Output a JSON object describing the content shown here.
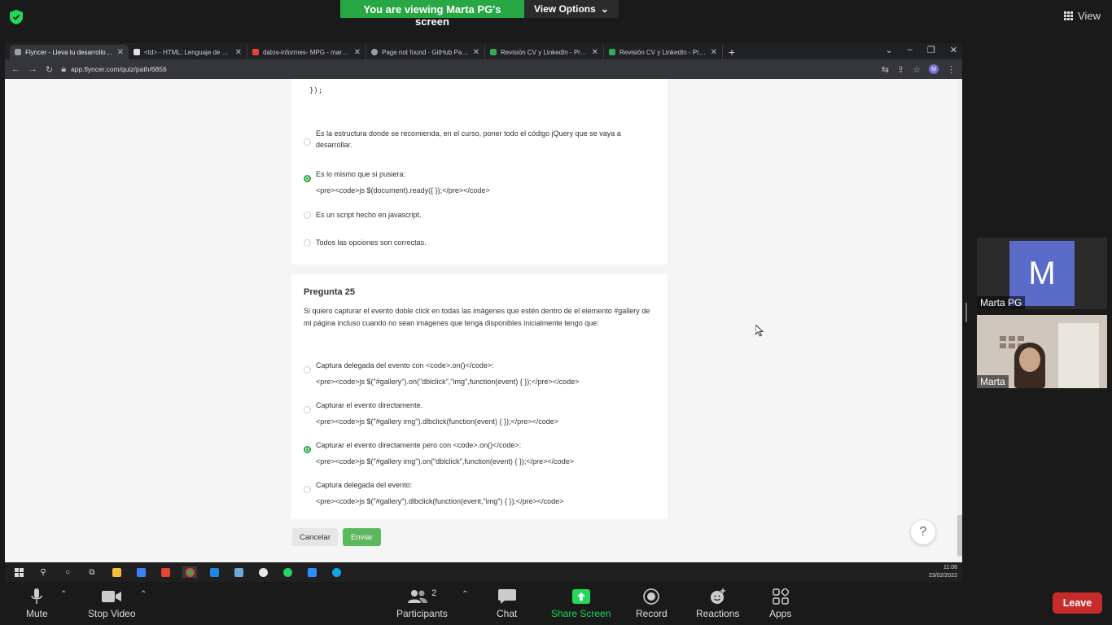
{
  "zoom": {
    "banner": "You are viewing Marta PG's screen",
    "view_options": "View Options",
    "view_label": "View",
    "bottom": {
      "mute": "Mute",
      "stop_video": "Stop Video",
      "participants": "Participants",
      "participants_count": "2",
      "chat": "Chat",
      "share_screen": "Share Screen",
      "record": "Record",
      "reactions": "Reactions",
      "apps": "Apps",
      "leave": "Leave"
    },
    "participants": [
      {
        "name": "Marta PG",
        "initial": "M"
      },
      {
        "name": "Marta"
      }
    ]
  },
  "browser": {
    "tabs": [
      {
        "label": "Flyncer - Lleva tu desarrollo prof",
        "icon_color": "#9aa0a6"
      },
      {
        "label": "<td> - HTML: Lenguaje de etique",
        "icon_color": "#e0e0e0"
      },
      {
        "label": "datos-informes- MPG - marta.pe",
        "icon_color": "#ea4335"
      },
      {
        "label": "Page not found · GitHub Pages",
        "icon_color": "#9aa0a6"
      },
      {
        "label": "Revisión CV y LinkedIn - Promo",
        "icon_color": "#34a853"
      },
      {
        "label": "Revisión CV y LinkedIn - Promo",
        "icon_color": "#34a853"
      }
    ],
    "url": "app.flyncer.com/quiz/path/6856"
  },
  "quiz": {
    "prev_code_tail": "});",
    "prev_options": [
      {
        "line1": "Es la estructura donde se recomienda, en el curso, poner todo el código jQuery que se vaya a",
        "line2": "desarrollar.",
        "checked": false
      },
      {
        "line1": "Es lo mismo que si pusiera:",
        "line2": "<pre><code>js $(document).ready({ });</pre></code>",
        "checked": true
      },
      {
        "line1": "Es un script hecho en javascript.",
        "line2": "",
        "checked": false
      },
      {
        "line1": "Todos las opciones son correctas.",
        "line2": "",
        "checked": false
      }
    ],
    "question_title": "Pregunta 25",
    "question_text": "Si quiero capturar el evento doble click en todas las imágenes que estén dentro de el elemento #gallery de mi página incluso cuando no sean imágenes que tenga disponibles inicialmente tengo que:",
    "options": [
      {
        "line1": "Captura delegada del evento con <code>.on()</code>:",
        "line2": "<pre><code>js $(\"#gallery\").on(\"dblclick\",\"img\",function(event) { });</pre></code>",
        "checked": false
      },
      {
        "line1": "Capturar el evento directamente.",
        "line2": "<pre><code>js $(\"#gallery img\").dlbclick(function(event) { });</pre></code>",
        "checked": false
      },
      {
        "line1": "Capturar el evento directamente pero con <code>.on()</code>:",
        "line2": "<pre><code>js $(\"#gallery img\").on(\"dblclick\",function(event) { });</pre></code>",
        "checked": true
      },
      {
        "line1": "Captura delegada del evento:",
        "line2": "<pre><code>js $(\"#gallery\").dlbclick(function(event,\"img\") { });</pre></code>",
        "checked": false
      }
    ],
    "cancel_label": "Cancelar",
    "send_label": "Enviar",
    "help_label": "?"
  },
  "taskbar": {
    "time": "11:08",
    "date": "23/02/2022"
  },
  "colors": {
    "zoom_green": "#27a844",
    "leave_red": "#c82b2b",
    "send_green": "#5cb85c",
    "share_green": "#23d959"
  }
}
